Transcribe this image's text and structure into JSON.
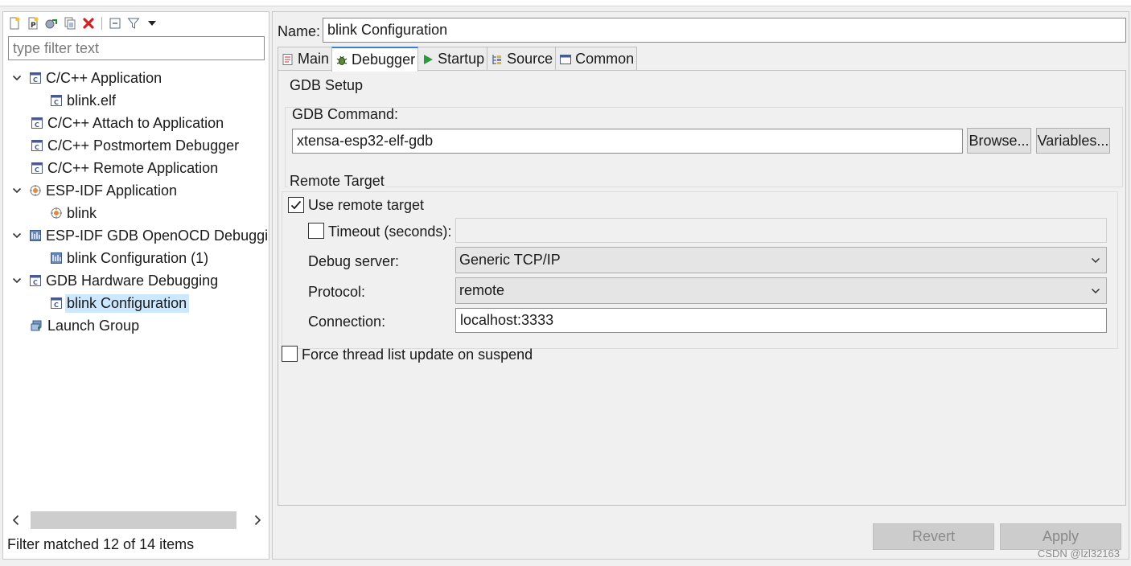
{
  "left_pane": {
    "toolbar": {
      "icons": [
        "new-configuration-icon",
        "new-prototype-icon",
        "export-icon",
        "duplicate-icon",
        "delete-icon",
        "collapse-all-icon",
        "filter-icon",
        "view-menu-icon"
      ]
    },
    "filter": {
      "placeholder": "type filter text",
      "value": ""
    },
    "tree": [
      {
        "label": "C/C++ Application",
        "level": 0,
        "expanded": true,
        "icon": "cpp-launch-icon"
      },
      {
        "label": "blink.elf",
        "level": 1,
        "icon": "cpp-launch-icon"
      },
      {
        "label": "C/C++ Attach to Application",
        "level": 0,
        "icon": "cpp-launch-icon"
      },
      {
        "label": "C/C++ Postmortem Debugger",
        "level": 0,
        "icon": "cpp-launch-icon"
      },
      {
        "label": "C/C++ Remote Application",
        "level": 0,
        "icon": "cpp-launch-icon"
      },
      {
        "label": "ESP-IDF Application",
        "level": 0,
        "expanded": true,
        "icon": "esp-idf-icon"
      },
      {
        "label": "blink",
        "level": 1,
        "icon": "esp-idf-icon"
      },
      {
        "label": "ESP-IDF GDB OpenOCD Debuggin",
        "level": 0,
        "expanded": true,
        "icon": "openocd-icon"
      },
      {
        "label": "blink Configuration (1)",
        "level": 1,
        "icon": "openocd-icon"
      },
      {
        "label": "GDB Hardware Debugging",
        "level": 0,
        "expanded": true,
        "icon": "cpp-launch-icon"
      },
      {
        "label": "blink Configuration",
        "level": 1,
        "icon": "cpp-launch-icon",
        "selected": true
      },
      {
        "label": "Launch Group",
        "level": 0,
        "icon": "launch-group-icon"
      }
    ],
    "status": "Filter matched 12 of 14 items"
  },
  "right_pane": {
    "name_label": "Name:",
    "name_value": "blink Configuration",
    "tabs": [
      {
        "label": "Main",
        "icon": "main-tab-icon"
      },
      {
        "label": "Debugger",
        "icon": "debugger-tab-icon",
        "active": true
      },
      {
        "label": "Startup",
        "icon": "startup-tab-icon"
      },
      {
        "label": "Source",
        "icon": "source-tab-icon"
      },
      {
        "label": "Common",
        "icon": "common-tab-icon"
      }
    ],
    "gdb_setup": {
      "title": "GDB Setup",
      "command_label": "GDB Command:",
      "command_value": "xtensa-esp32-elf-gdb",
      "browse_label": "Browse...",
      "variables_label": "Variables..."
    },
    "remote_target": {
      "title": "Remote Target",
      "use_remote_label": "Use remote target",
      "use_remote_checked": true,
      "timeout_label": "Timeout (seconds):",
      "timeout_checked": false,
      "timeout_value": "",
      "debug_server_label": "Debug server:",
      "debug_server_value": "Generic TCP/IP",
      "protocol_label": "Protocol:",
      "protocol_value": "remote",
      "connection_label": "Connection:",
      "connection_value": "localhost:3333"
    },
    "force_thread_label": "Force thread list update on suspend",
    "force_thread_checked": false,
    "revert_label": "Revert",
    "apply_label": "Apply"
  },
  "watermark": "CSDN @lzl32163",
  "colors": {
    "selection": "#cce8ff",
    "tab_accent": "#3b80d0",
    "delete_red": "#d42020"
  }
}
